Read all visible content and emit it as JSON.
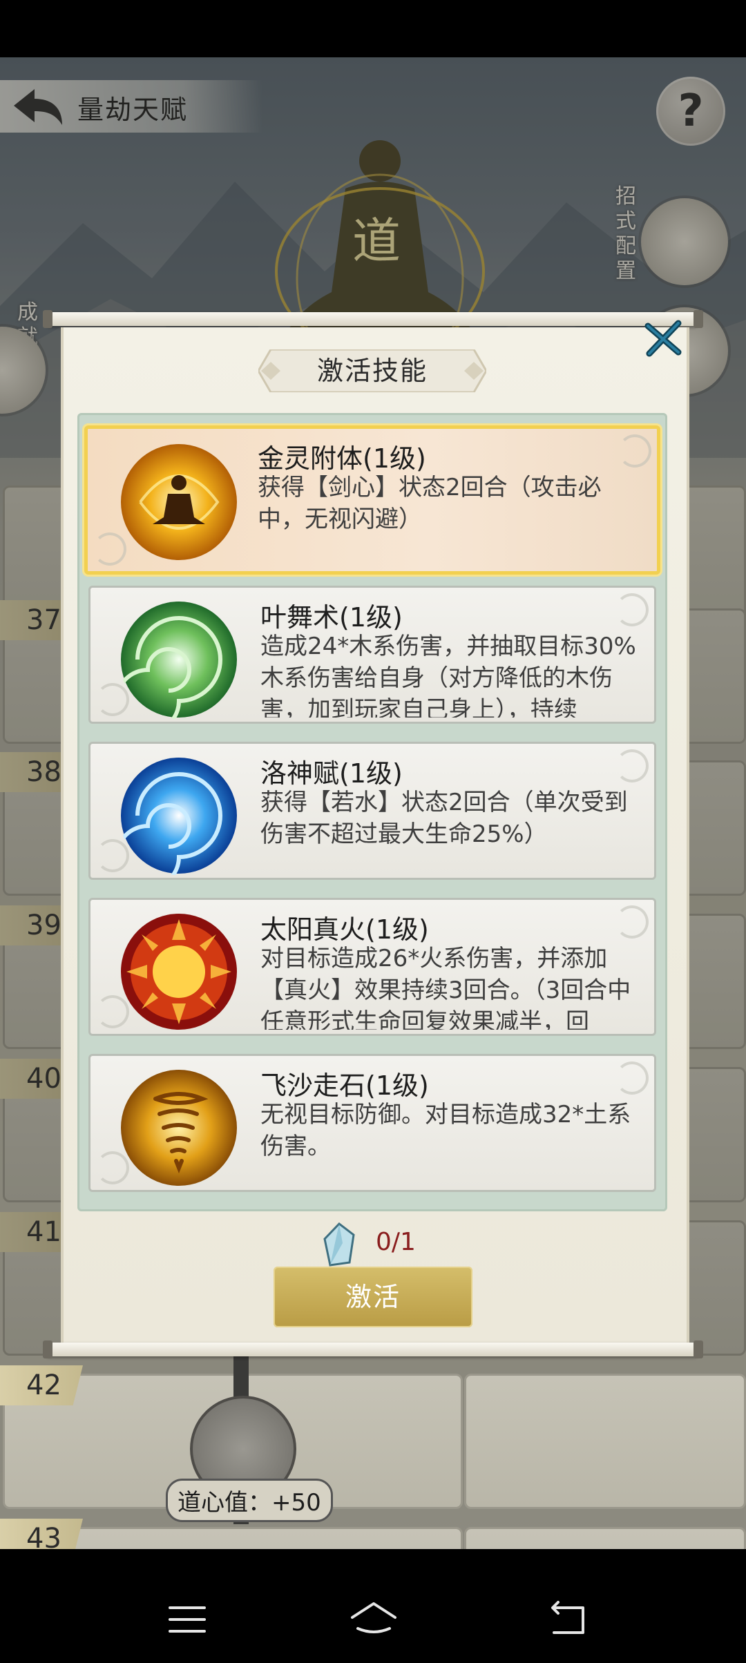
{
  "header": {
    "title": "量劫天赋"
  },
  "side_labels": {
    "left": "成就",
    "right_top": "招式配置"
  },
  "levels": [
    {
      "num": "37"
    },
    {
      "num": "38"
    },
    {
      "num": "39"
    },
    {
      "num": "40"
    },
    {
      "num": "41"
    },
    {
      "num": "42",
      "value_tag": "道心值：+50"
    },
    {
      "num": "43"
    }
  ],
  "dialog": {
    "title": "激活技能",
    "skills": [
      {
        "name": "金灵附体(1级)",
        "desc": "获得【剑心】状态2回合（攻击必中，无视闪避）",
        "icon": "golden-meditation-icon",
        "selected": true
      },
      {
        "name": "叶舞术(1级)",
        "desc": "造成24*木系伤害，并抽取目标30%木系伤害给自身（对方降低的木伤害，加到玩家自己身上），持续",
        "icon": "leaf-swirl-icon",
        "selected": false
      },
      {
        "name": "洛神赋(1级)",
        "desc": "获得【若水】状态2回合（单次受到伤害不超过最大生命25%）",
        "icon": "water-vortex-icon",
        "selected": false
      },
      {
        "name": "太阳真火(1级)",
        "desc": "对目标造成26*火系伤害，并添加【真火】效果持续3回合。（3回合中任意形式生命回复效果减半，回",
        "icon": "sun-fire-icon",
        "selected": false
      },
      {
        "name": "飞沙走石(1级)",
        "desc": "无视目标防御。对目标造成32*土系伤害。",
        "icon": "sand-tornado-icon",
        "selected": false
      }
    ],
    "cost": "0/1",
    "activate_label": "激活"
  }
}
